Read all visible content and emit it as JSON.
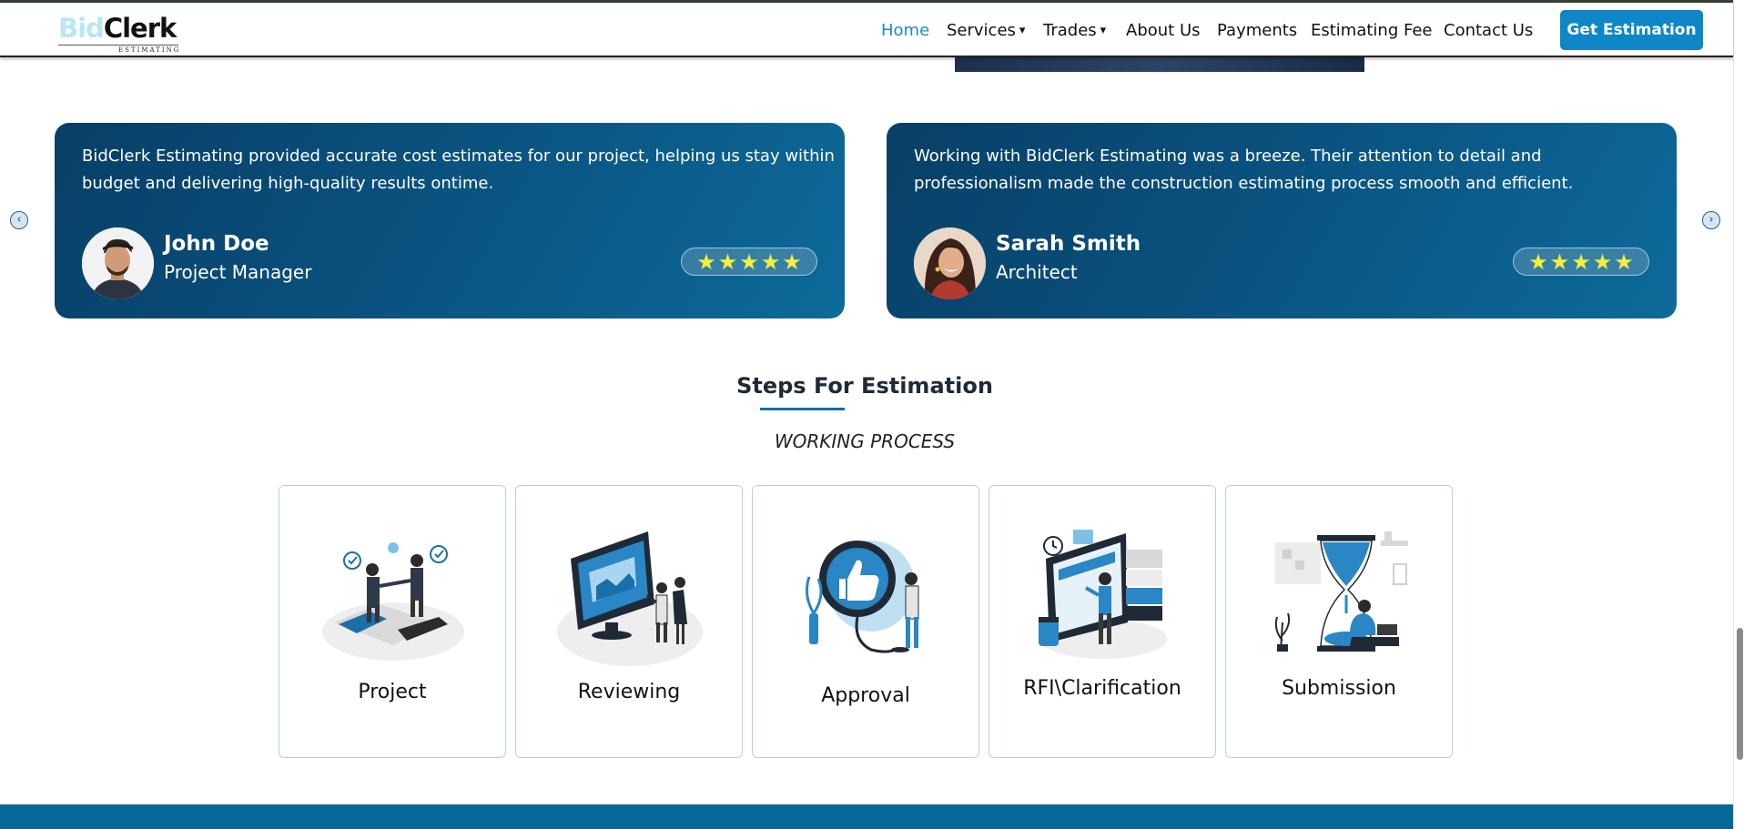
{
  "brand": {
    "logo_part1": "Bid",
    "logo_part2": "Clerk",
    "logo_sub": "ESTIMATING"
  },
  "nav": {
    "items": [
      {
        "label": "Home",
        "active": true
      },
      {
        "label": "Services",
        "dropdown": true
      },
      {
        "label": "Trades",
        "dropdown": true
      },
      {
        "label": "About Us"
      },
      {
        "label": "Payments"
      },
      {
        "label": "Estimating Fee"
      },
      {
        "label": "Contact Us"
      }
    ],
    "caret": "▾",
    "cta": "Get Estimation"
  },
  "carousel": {
    "prev_icon": "chevron-left-icon",
    "next_icon": "chevron-right-icon",
    "prev_glyph": "‹",
    "next_glyph": "›",
    "testimonials": [
      {
        "quote": "BidClerk Estimating provided accurate cost estimates for our project, helping us stay within budget and delivering high-quality results ontime.",
        "name": "John Doe",
        "role": "Project Manager",
        "rating": 5
      },
      {
        "quote": "Working with BidClerk Estimating was a breeze. Their attention to detail and professionalism made the construction estimating process smooth and efficient.",
        "name": "Sarah Smith",
        "role": "Architect",
        "rating": 5
      }
    ],
    "star_glyph": "★"
  },
  "steps": {
    "title": "Steps For Estimation",
    "subtitle": "WORKING PROCESS",
    "items": [
      {
        "label": "Project",
        "icon": "handshake-puzzle-illustration"
      },
      {
        "label": "Reviewing",
        "icon": "monitor-review-illustration"
      },
      {
        "label": "Approval",
        "icon": "thumbs-up-approval-illustration"
      },
      {
        "label": "RFI\\Clarification",
        "icon": "documents-clarification-illustration"
      },
      {
        "label": "Submission",
        "icon": "hourglass-submission-illustration"
      }
    ]
  },
  "colors": {
    "primary": "#0f87c6",
    "card_dark": "#083f66",
    "footer": "#08679a",
    "star": "#f4ef3b",
    "logo_accent": "#b9e6f7"
  }
}
